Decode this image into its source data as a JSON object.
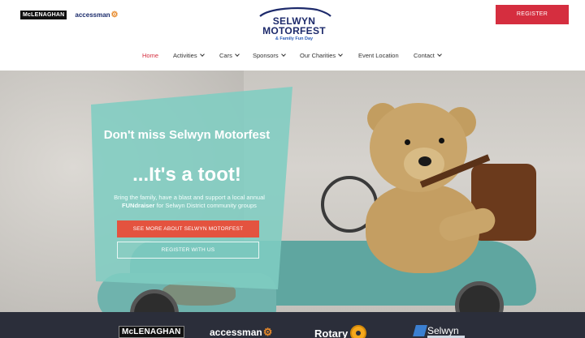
{
  "header": {
    "sponsors_small": {
      "mclenaghan": "McLENAGHAN",
      "accessman": "accessman"
    },
    "brand": {
      "line1": "SELWYN",
      "line2": "MOTORFEST",
      "line3": "& Family Fun Day"
    },
    "register_label": "REGISTER"
  },
  "nav": {
    "items": [
      {
        "label": "Home",
        "has_dropdown": false,
        "active": true
      },
      {
        "label": "Activities",
        "has_dropdown": true
      },
      {
        "label": "Cars",
        "has_dropdown": true
      },
      {
        "label": "Sponsors",
        "has_dropdown": true
      },
      {
        "label": "Our Charities",
        "has_dropdown": true
      },
      {
        "label": "Event Location",
        "has_dropdown": false
      },
      {
        "label": "Contact",
        "has_dropdown": true
      }
    ]
  },
  "hero": {
    "title": "Don't miss Selwyn Motorfest",
    "tagline": "...It's a toot!",
    "body_prefix": "Bring the family, have a blast and support a local annual ",
    "body_bold": "FUNdraiser",
    "body_suffix": " for Selwyn District community groups",
    "primary_button": "SEE MORE ABOUT SELWYN MOTORFEST",
    "secondary_button": "REGISTER WITH US"
  },
  "footer": {
    "sponsors": {
      "mclenaghan": "McLENAGHAN",
      "accessman": "accessman",
      "rotary": "Rotary",
      "selwyn": "Selwyn"
    }
  },
  "colors": {
    "accent_red": "#d52e3f",
    "cta_orange": "#e4533f",
    "panel_teal": "#7fcdc2",
    "brand_navy": "#1d2a6b",
    "footer_bg": "#2b2e3a"
  }
}
